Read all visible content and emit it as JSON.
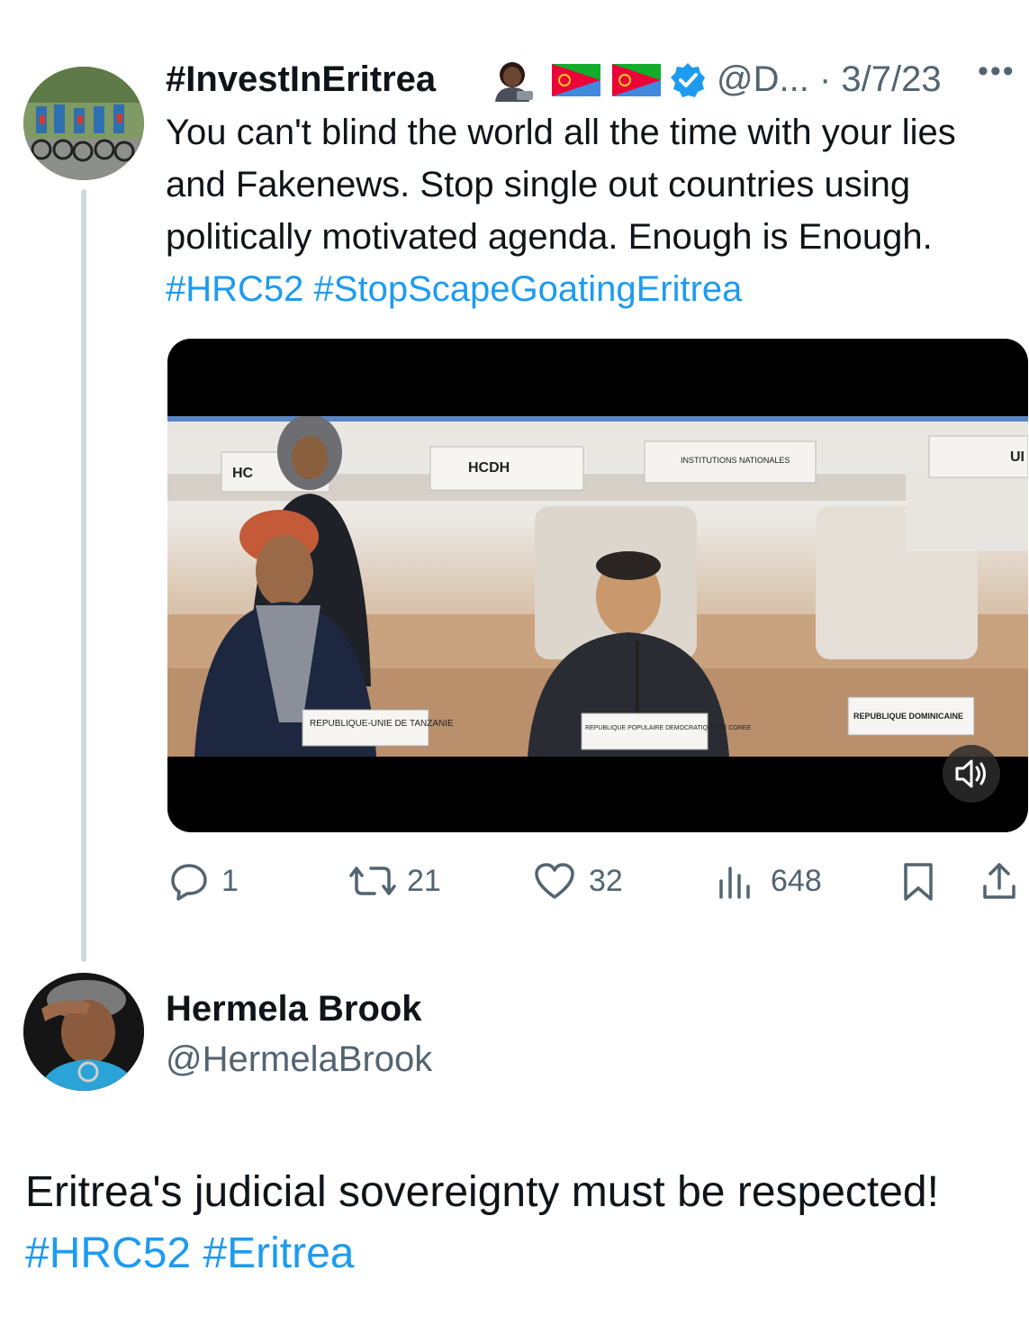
{
  "quoted_tweet": {
    "author_name": "#InvestInEritrea",
    "handle_and_date": "@D... · 3/7/23",
    "more_icon": "more-horizontal-icon",
    "text_plain": "You can't blind the world all the time with your lies and Fakenews. Stop single out countries using politically motivated agenda. Enough is Enough.",
    "hashtags": [
      "#HRC52",
      "#StopScapeGoatingEritrea"
    ],
    "video": {
      "placards": [
        "HC",
        "HCDH",
        "INSTITUTIONS NATIONALES",
        "UI",
        "REPUBLIQUE-UNIE DE TANZANIE",
        "REPUBLIQUE POPULAIRE DEMOCRATIQUE DE COREE",
        "REPUBLIQUE DOMINICAINE"
      ],
      "mute_icon": "speaker-icon"
    },
    "actions": {
      "replies": "1",
      "retweets": "21",
      "likes": "32",
      "views": "648"
    }
  },
  "reply": {
    "author_name": "Hermela Brook",
    "handle": "@HermelaBrook",
    "text_plain": "Eritrea's judicial sovereignty must be respected!",
    "hashtags": [
      "#HRC52",
      "#Eritrea"
    ]
  },
  "colors": {
    "link": "#1d9bf0",
    "secondary_text": "#536471",
    "verified": "#1d9bf0"
  }
}
